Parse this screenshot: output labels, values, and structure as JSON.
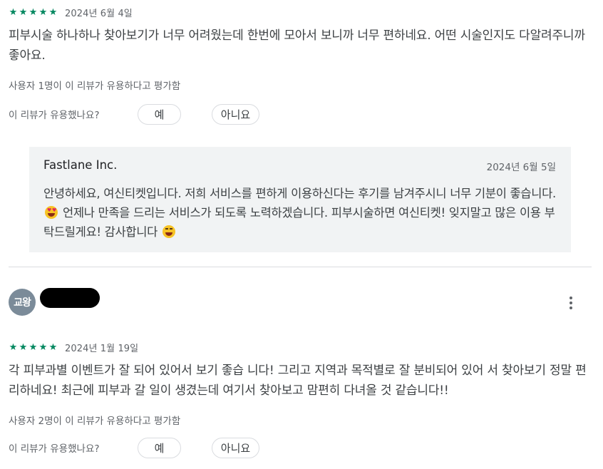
{
  "reviews": [
    {
      "rating": 5,
      "date": "2024년 6월 4일",
      "text": "피부시술 하나하나 찾아보기가 너무 어려웠는데 한번에 모아서 보니까 너무 편하네요. 어떤 시술인지도 다알려주니까 좋아요.",
      "helpful_count": "사용자 1명이 이 리뷰가 유용하다고 평가함",
      "helpful_question": "이 리뷰가 유용했나요?",
      "yes_label": "예",
      "no_label": "아니요",
      "reply": {
        "developer": "Fastlane Inc.",
        "date": "2024년 6월 5일",
        "text_part1": "안녕하세요, 여신티켓입니다. 저희 서비스를 편하게 이용하신다는 후기를 남겨주시니 너무 기분이 좋습니다.",
        "emoji1": "heart-eyes-emoji",
        "text_part2": " 언제나 만족을 드리는 서비스가 되도록 노력하겠습니다. 피부시술하면 여신티켓! 잊지말고 많은 이용 부탁드릴게요! 감사합니다",
        "emoji2": "grinning-squint-emoji"
      }
    },
    {
      "avatar_text": "교왕",
      "rating": 5,
      "date": "2024년 1월 19일",
      "text": "각 피부과별 이벤트가 잘 되어 있어서 보기 좋습 니다! 그리고 지역과 목적별로 잘 분비되어 있어 서 찾아보기 정말 편리하네요! 최근에 피부과 갈 일이 생겼는데 여기서 찾아보고 맘편히 다녀올 것 같습니다!!",
      "helpful_count": "사용자 2명이 이 리뷰가 유용하다고 평가함",
      "helpful_question": "이 리뷰가 유용했나요?",
      "yes_label": "예",
      "no_label": "아니요"
    }
  ],
  "colors": {
    "star": "#01875f",
    "reply_bg": "#f1f3f4",
    "avatar_bg": "#7b8b99",
    "secondary_text": "#5f6368"
  },
  "icons": {
    "star": "star-icon",
    "more": "more-vert-icon"
  }
}
